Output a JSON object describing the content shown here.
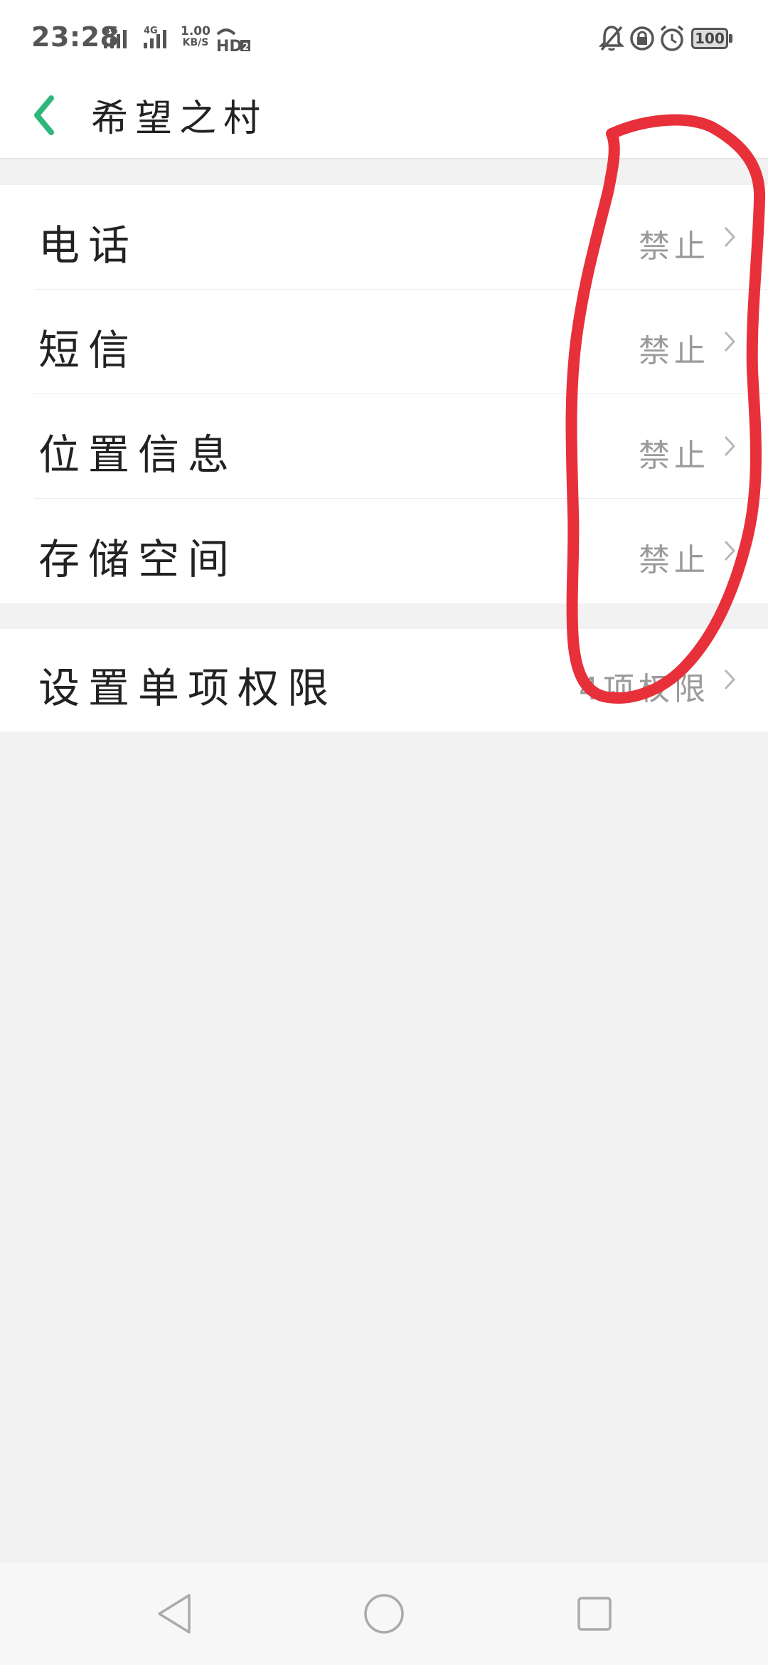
{
  "status_bar": {
    "time": "23:28",
    "network_1": "4G",
    "network_2": "4G",
    "speed_value": "1.00",
    "speed_unit": "KB/S",
    "hd_label": "HD",
    "hd_sub": "2",
    "battery": "100"
  },
  "header": {
    "title": "希望之村"
  },
  "permissions": [
    {
      "label": "电话",
      "value": "禁止"
    },
    {
      "label": "短信",
      "value": "禁止"
    },
    {
      "label": "位置信息",
      "value": "禁止"
    },
    {
      "label": "存储空间",
      "value": "禁止"
    }
  ],
  "single_permission": {
    "label": "设置单项权限",
    "value": "4项权限"
  },
  "colors": {
    "accent": "#2fb67b",
    "annotation": "#e8303a",
    "background": "#f2f2f2"
  }
}
